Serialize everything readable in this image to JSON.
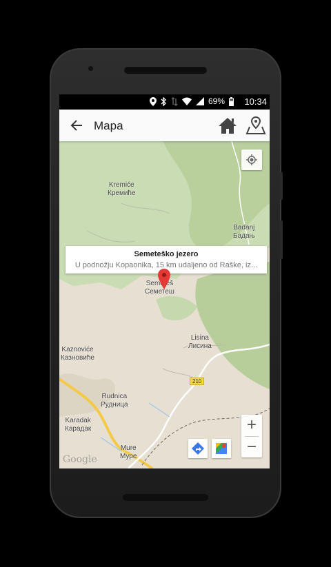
{
  "status": {
    "battery": "69%",
    "time": "10:34"
  },
  "appbar": {
    "title": "Mapa",
    "back_icon": "arrow-left-icon",
    "home_icon": "home-icon",
    "route_icon": "map-route-icon"
  },
  "popup": {
    "title": "Semeteško jezero",
    "subtitle": "U podnožju Kopaonika, 15 km udaljeno od Raške, iz..."
  },
  "places": [
    {
      "latin": "Kremiće",
      "cyr": "Кремиће"
    },
    {
      "latin": "Badanj",
      "cyr": "Бадањ"
    },
    {
      "latin": "Semeteš",
      "cyr": "Семетеш"
    },
    {
      "latin": "Lisina",
      "cyr": "Лисина"
    },
    {
      "latin": "Kaznoviće",
      "cyr": "Казновиће"
    },
    {
      "latin": "Rudnica",
      "cyr": "Рудница"
    },
    {
      "latin": "Karadak",
      "cyr": "Карадак"
    },
    {
      "latin": "Mure",
      "cyr": "Муре"
    }
  ],
  "road_number": "210",
  "map_controls": {
    "zoom_in": "+",
    "zoom_out": "−",
    "attribution": "Google"
  },
  "colors": {
    "marker": "#e53935",
    "shield": "#f8d64a",
    "forest": "#c8dcb0",
    "terrain": "#e6dfd2"
  }
}
